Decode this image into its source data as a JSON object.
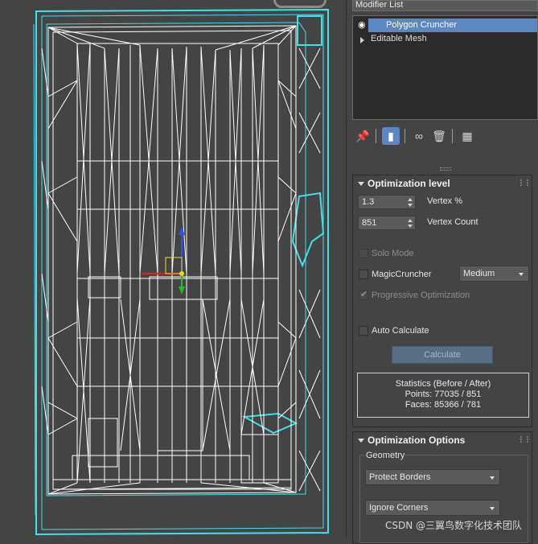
{
  "modifier_list": {
    "label": "Modifier List"
  },
  "stack": {
    "items": [
      {
        "label": "Polygon Cruncher",
        "selected": true
      },
      {
        "label": "Editable Mesh",
        "selected": false
      }
    ]
  },
  "toolbar": {
    "icons": [
      "pin-stack-icon",
      "show-end-result-icon",
      "make-unique-icon",
      "remove-modifier-icon",
      "configure-modifier-sets-icon"
    ]
  },
  "optimization_level": {
    "title": "Optimization level",
    "vertex_pct": {
      "value": "1.3",
      "label": "Vertex %"
    },
    "vertex_count": {
      "value": "851",
      "label": "Vertex Count"
    },
    "solo_mode": "Solo Mode",
    "magic_cruncher": "MagicCruncher",
    "magic_level": "Medium",
    "progressive": "Progressive Optimization",
    "auto_calculate": "Auto Calculate",
    "calculate": "Calculate",
    "stats": {
      "heading": "Statistics (Before / After)",
      "points": "Points: 77035 / 851",
      "faces": "Faces: 85366 / 781"
    }
  },
  "optimization_options": {
    "title": "Optimization Options",
    "geometry_group": "Geometry",
    "protect_borders": "Protect Borders",
    "ignore_corners": "Ignore Corners"
  },
  "watermark": "CSDN @三翼鸟数字化技术团队",
  "colors": {
    "accent": "#5d87c2",
    "wire": "#ffffff",
    "selection": "#3fe0e8",
    "background": "#444444"
  }
}
